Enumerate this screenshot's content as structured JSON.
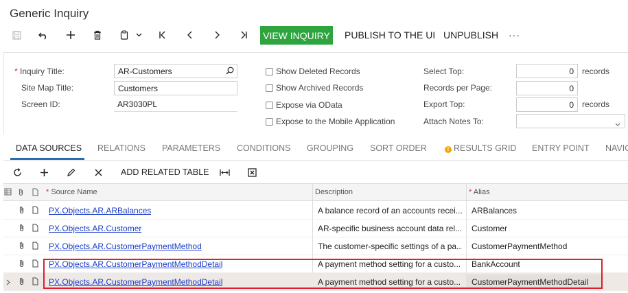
{
  "page_title": "Generic Inquiry",
  "toolbar": {
    "view_inquiry": "VIEW INQUIRY",
    "publish": "PUBLISH TO THE UI",
    "unpublish": "UNPUBLISH",
    "more": "···"
  },
  "form": {
    "inquiry_title_label": "Inquiry Title:",
    "inquiry_title_value": "AR-Customers",
    "site_map_title_label": "Site Map Title:",
    "site_map_title_value": "Customers",
    "screen_id_label": "Screen ID:",
    "screen_id_value": "AR3030PL",
    "show_deleted": "Show Deleted Records",
    "show_archived": "Show Archived Records",
    "expose_odata": "Expose via OData",
    "expose_mobile": "Expose to the Mobile Application",
    "select_top_label": "Select Top:",
    "select_top_value": "0",
    "records_per_page_label": "Records per Page:",
    "records_per_page_value": "0",
    "export_top_label": "Export Top:",
    "export_top_value": "0",
    "attach_notes_label": "Attach Notes To:",
    "attach_notes_value": "",
    "records_suffix": "records"
  },
  "tabs": [
    "DATA SOURCES",
    "RELATIONS",
    "PARAMETERS",
    "CONDITIONS",
    "GROUPING",
    "SORT ORDER",
    "RESULTS GRID",
    "ENTRY POINT",
    "NAVIG"
  ],
  "grid_toolbar": {
    "add_related_table": "ADD RELATED TABLE"
  },
  "grid": {
    "columns": {
      "source_name": "Source Name",
      "description": "Description",
      "alias": "Alias"
    },
    "rows": [
      {
        "source": "PX.Objects.AR.ARBalances",
        "description": "A balance record of an accounts recei...",
        "alias": "ARBalances"
      },
      {
        "source": "PX.Objects.AR.Customer",
        "description": "AR-specific business account data rel...",
        "alias": "Customer"
      },
      {
        "source": "PX.Objects.AR.CustomerPaymentMethod",
        "description": "The customer-specific settings of a pa...",
        "alias": "CustomerPaymentMethod"
      },
      {
        "source": "PX.Objects.AR.CustomerPaymentMethodDetail",
        "description": "A payment method setting for a custo...",
        "alias": "BankAccount"
      },
      {
        "source": "PX.Objects.AR.CustomerPaymentMethodDetail",
        "description": "A payment method setting for a custo...",
        "alias": "CustomerPaymentMethodDetail"
      }
    ]
  },
  "colors": {
    "primary_button": "#2ea43f",
    "link": "#1a3ec7",
    "highlight_border": "#d9202b",
    "active_tab": "#2b6cb0"
  }
}
